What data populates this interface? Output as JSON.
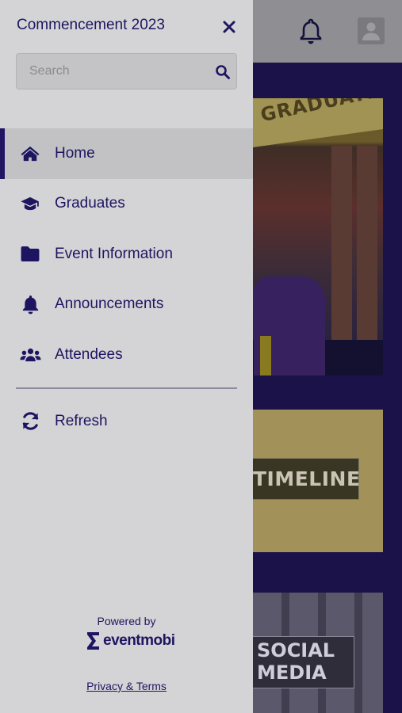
{
  "drawer": {
    "title": "Commencement 2023",
    "close_icon": "close-icon",
    "search": {
      "placeholder": "Search",
      "value": "",
      "icon": "search-icon"
    },
    "nav_items": [
      {
        "label": "Home",
        "icon": "home-icon",
        "active": true
      },
      {
        "label": "Graduates",
        "icon": "graduation-cap-icon",
        "active": false
      },
      {
        "label": "Event Information",
        "icon": "folder-icon",
        "active": false
      },
      {
        "label": "Announcements",
        "icon": "bell-icon",
        "active": false
      },
      {
        "label": "Attendees",
        "icon": "users-icon",
        "active": false
      }
    ],
    "refresh": {
      "label": "Refresh",
      "icon": "refresh-icon"
    },
    "footer": {
      "powered_by": "Powered by",
      "brand": "eventmobi",
      "privacy_link": "Privacy & Terms"
    }
  },
  "background": {
    "header_icons": [
      "bell-icon",
      "user-avatar-icon"
    ],
    "tiles": [
      {
        "banner_text": "GRADUATING"
      },
      {
        "label": "TIMELINE"
      },
      {
        "label_line1": "SOCIAL",
        "label_line2": "MEDIA"
      }
    ]
  },
  "colors": {
    "accent": "#211463",
    "drawer_bg": "#d4d4d6",
    "active_item_bg": "#c2c2c5",
    "overlay_bg": "#1b1249"
  }
}
